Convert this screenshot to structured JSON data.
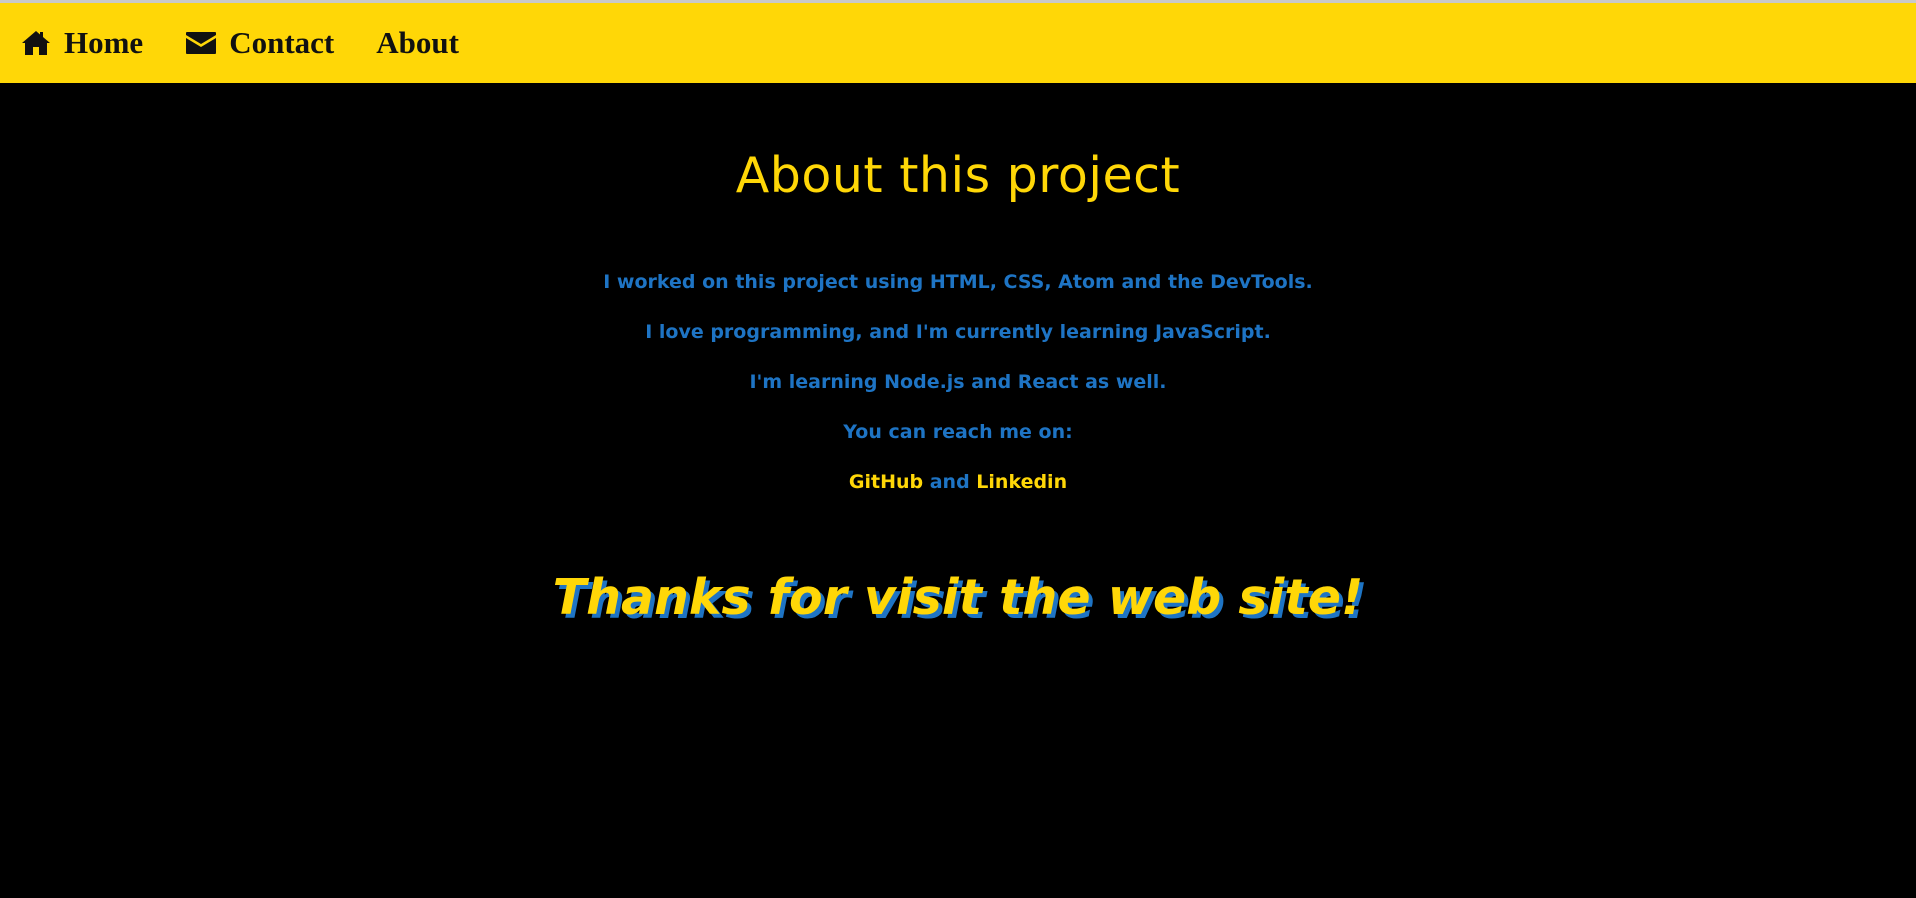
{
  "nav": {
    "home": {
      "label": "Home",
      "icon": "home-icon"
    },
    "contact": {
      "label": "Contact",
      "icon": "envelope-icon"
    },
    "about": {
      "label": "About"
    }
  },
  "main": {
    "title": "About this project",
    "paragraphs": [
      "I worked on this project using HTML, CSS, Atom and the DevTools.",
      "I love programming, and I'm currently learning JavaScript.",
      "I'm learning Node.js and React as well.",
      "You can reach me on:"
    ],
    "links": {
      "github": "GitHub",
      "connector": "and",
      "linkedin": "Linkedin"
    },
    "thanks": "Thanks for visit the web site!"
  },
  "colors": {
    "navbar_bg": "#FFD707",
    "page_bg": "#000000",
    "accent_yellow": "#FFD707",
    "text_blue": "#1E74C4"
  }
}
